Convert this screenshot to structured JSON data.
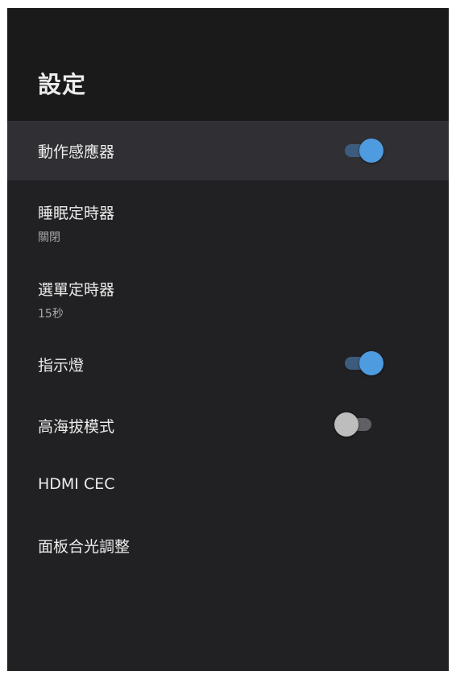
{
  "header": {
    "title": "設定"
  },
  "settings": {
    "items": [
      {
        "title": "動作感應器",
        "subtitle": "",
        "toggle": "on",
        "focused": true
      },
      {
        "title": "睡眠定時器",
        "subtitle": "關閉"
      },
      {
        "title": "選單定時器",
        "subtitle": "15秒"
      },
      {
        "title": "指示燈",
        "subtitle": "",
        "toggle": "on"
      },
      {
        "title": "高海拔模式",
        "subtitle": "",
        "toggle": "off"
      },
      {
        "title": "HDMI CEC",
        "subtitle": ""
      },
      {
        "title": "面板合光調整",
        "subtitle": ""
      }
    ]
  },
  "colors": {
    "background": "#212123",
    "header_background": "#1a1a1b",
    "focused_row": "#303034",
    "toggle_on_thumb": "#4e9be0",
    "toggle_on_track": "#3d5c7d",
    "toggle_off_thumb": "#bdbdbd",
    "toggle_off_track": "#5f6063",
    "text_primary": "#ececec",
    "text_secondary": "#a8a8ac"
  }
}
